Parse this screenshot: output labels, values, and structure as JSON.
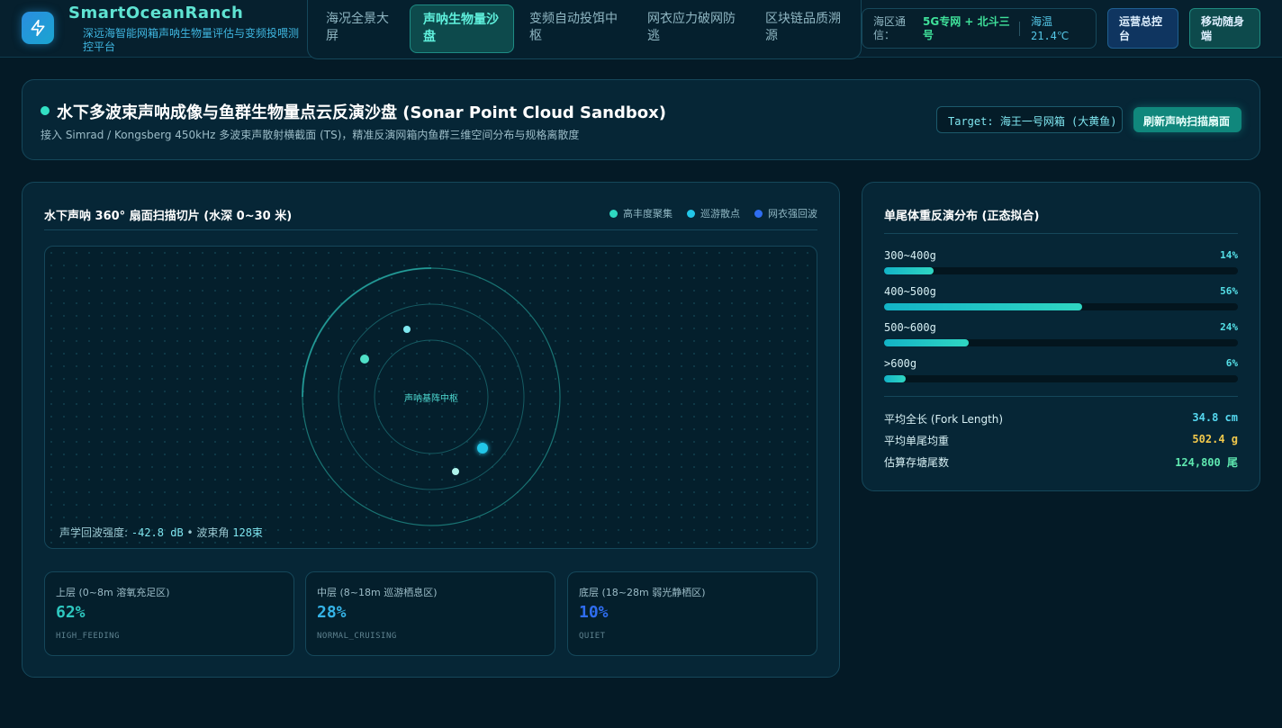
{
  "brand": {
    "title": "SmartOceanRanch",
    "subtitle": "深远海智能网箱声呐生物量评估与变频投喂测控平台",
    "logo_icon": "lightning-bolt-icon"
  },
  "nav": {
    "items": [
      {
        "label": "海况全景大屏",
        "active": false
      },
      {
        "label": "声呐生物量沙盘",
        "active": true
      },
      {
        "label": "变频自动投饵中枢",
        "active": false
      },
      {
        "label": "网衣应力破网防逃",
        "active": false
      },
      {
        "label": "区块链品质溯源",
        "active": false
      }
    ]
  },
  "status": {
    "comm_label": "海区通信：",
    "comm_value": "5G专网 + 北斗三号",
    "temp_label": "海温",
    "temp_value": "21.4℃"
  },
  "header_buttons": {
    "ops": "运营总控台",
    "mobile": "移动随身端"
  },
  "page": {
    "title": "水下多波束声呐成像与鱼群生物量点云反演沙盘 (Sonar Point Cloud Sandbox)",
    "subtitle": "接入 Simrad / Kongsberg 450kHz 多波束声散射横截面 (TS)，精准反演网箱内鱼群三维空间分布与规格离散度",
    "target_label": "Target:",
    "target_value": "海王一号网箱 (大黄鱼)",
    "refresh_button": "刷新声呐扫描扇面"
  },
  "sonar": {
    "title": "水下声呐 360° 扇面扫描切片 (水深 0~30 米)",
    "legend": [
      {
        "label": "高丰度聚集",
        "color": "#2ed8c0"
      },
      {
        "label": "巡游散点",
        "color": "#22c6e8"
      },
      {
        "label": "网衣强回波",
        "color": "#2f6df0"
      }
    ],
    "center_label": "声呐基阵中枢",
    "readout_label": "声学回波强度:",
    "readout_value": "-42.8 dB",
    "readout_sep": "•",
    "beam_label": "波束角",
    "beam_value": "128束"
  },
  "layers": [
    {
      "label": "上层 (0~8m 溶氧充足区)",
      "value": "62%",
      "code": "HIGH_FEEDING",
      "color": "#2ec8c0"
    },
    {
      "label": "中层 (8~18m 巡游栖息区)",
      "value": "28%",
      "code": "NORMAL_CRUISING",
      "color": "#35b4e8"
    },
    {
      "label": "底层 (18~28m 弱光静栖区)",
      "value": "10%",
      "code": "QUIET",
      "color": "#2f6df0"
    }
  ],
  "weight": {
    "title": "单尾体重反演分布 (正态拟合)",
    "bins": [
      {
        "label": "300~400g",
        "pct_text": "14%",
        "pct": 14
      },
      {
        "label": "400~500g",
        "pct_text": "56%",
        "pct": 56
      },
      {
        "label": "500~600g",
        "pct_text": "24%",
        "pct": 24
      },
      {
        "label": ">600g",
        "pct_text": "6%",
        "pct": 6
      }
    ],
    "stats": [
      {
        "label": "平均全长 (Fork Length)",
        "value": "34.8 cm",
        "color": "#55d8f0"
      },
      {
        "label": "平均单尾均重",
        "value": "502.4 g",
        "color": "#f2c94c"
      },
      {
        "label": "估算存塘尾数",
        "value": "124,800 尾",
        "color": "#5fe8b0"
      }
    ]
  }
}
